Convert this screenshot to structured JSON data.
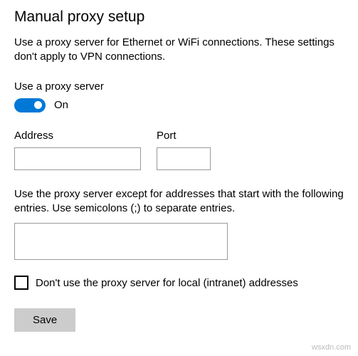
{
  "heading": "Manual proxy setup",
  "description": "Use a proxy server for Ethernet or WiFi connections. These settings don't apply to VPN connections.",
  "toggle": {
    "label": "Use a proxy server",
    "state": "On",
    "value": true
  },
  "address": {
    "label": "Address",
    "value": ""
  },
  "port": {
    "label": "Port",
    "value": ""
  },
  "exceptions": {
    "description": "Use the proxy server except for addresses that start with the following entries. Use semicolons (;) to separate entries.",
    "value": ""
  },
  "local_bypass": {
    "label": "Don't use the proxy server for local (intranet) addresses",
    "checked": false
  },
  "save_label": "Save",
  "watermark": "wsxdn.com"
}
